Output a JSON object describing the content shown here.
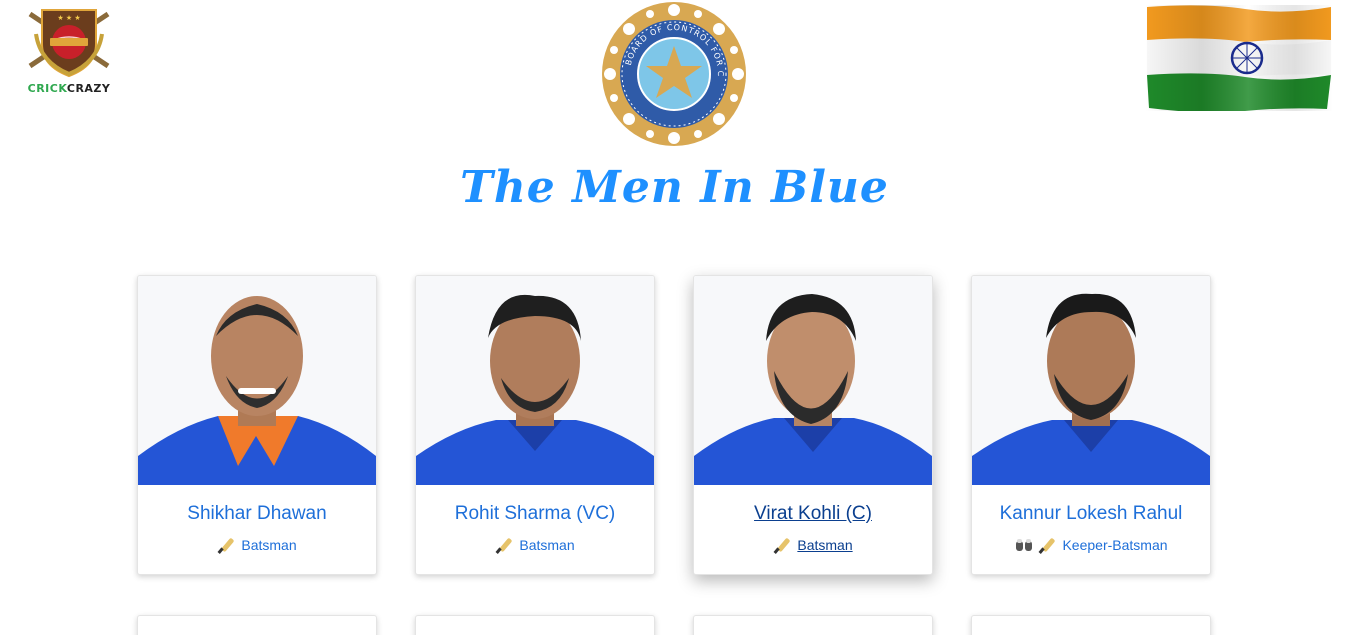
{
  "header": {
    "brand": {
      "part1": "CRICK",
      "part2": "CRAZY"
    },
    "title": "The Men In Blue",
    "bcci_logo_icon": "bcci-emblem",
    "flag_icon": "india-flag"
  },
  "colors": {
    "title": "#1e90ff",
    "link": "#1e6fd9",
    "link_hover": "#0b3f8f",
    "jersey": "#2455d6"
  },
  "players": [
    {
      "name": "Shikhar Dhawan",
      "role": "Batsman",
      "icons": [
        "bat-icon"
      ]
    },
    {
      "name": "Rohit Sharma (VC)",
      "role": "Batsman",
      "icons": [
        "bat-icon"
      ]
    },
    {
      "name": "Virat Kohli (C)",
      "role": "Batsman",
      "icons": [
        "bat-icon"
      ]
    },
    {
      "name": "Kannur Lokesh Rahul",
      "role": "Keeper-Batsman",
      "icons": [
        "keeper-gloves-icon",
        "bat-icon"
      ]
    }
  ]
}
